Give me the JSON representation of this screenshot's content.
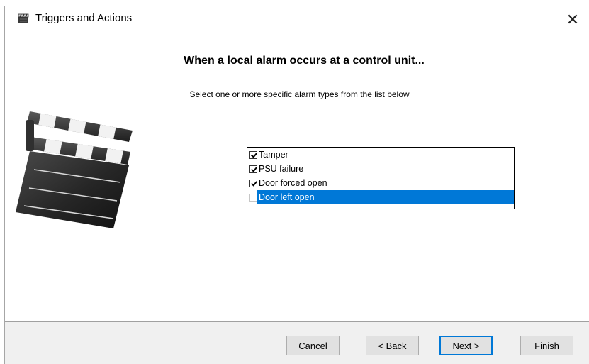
{
  "window": {
    "title": "Triggers and Actions",
    "close_glyph": "✕"
  },
  "header": {
    "heading": "When a local alarm occurs at a control unit...",
    "instruction": "Select one or more specific alarm types from the list below"
  },
  "alarm_list": {
    "items": [
      {
        "label": "Tamper",
        "checked": true,
        "selected": false
      },
      {
        "label": "PSU failure",
        "checked": true,
        "selected": false
      },
      {
        "label": "Door forced open",
        "checked": true,
        "selected": false
      },
      {
        "label": "Door left open",
        "checked": false,
        "selected": true
      }
    ]
  },
  "buttons": {
    "cancel": "Cancel",
    "back": "< Back",
    "next": "Next >",
    "finish": "Finish"
  },
  "icons": {
    "title_icon": "clapperboard-icon",
    "illustration": "clapperboard-icon"
  },
  "colors": {
    "selection": "#0078d7",
    "footer_bg": "#f0f0f0",
    "button_face": "#e1e1e1",
    "default_button_border": "#0078d7"
  }
}
